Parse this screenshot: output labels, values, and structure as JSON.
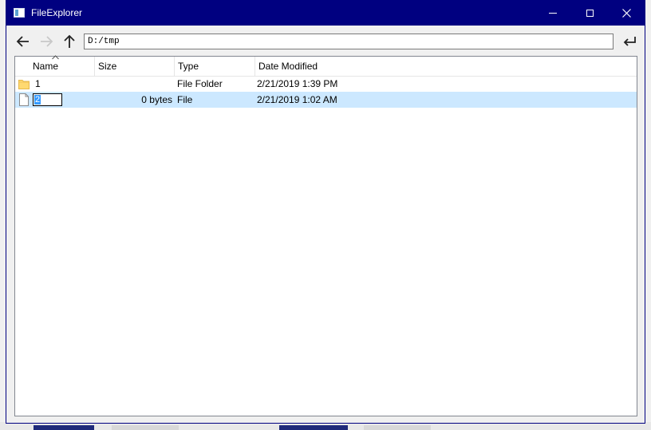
{
  "window": {
    "title": "FileExplorer"
  },
  "toolbar": {
    "back_icon": "arrow-left-icon",
    "forward_icon": "arrow-right-icon",
    "up_icon": "arrow-up-icon",
    "go_icon": "enter-return-icon",
    "address_value": "D:/tmp"
  },
  "list": {
    "columns": {
      "name": "Name",
      "size": "Size",
      "type": "Type",
      "date": "Date Modified"
    },
    "sort": {
      "column": "Name",
      "direction": "ascending"
    },
    "rows": [
      {
        "name": "1",
        "size": "",
        "type": "File Folder",
        "date": "2/21/2019 1:39 PM",
        "icon": "folder-icon"
      },
      {
        "name": "2",
        "size": "0 bytes",
        "type": "File",
        "date": "2/21/2019 1:02 AM",
        "icon": "file-icon",
        "editing": true
      }
    ]
  },
  "colors": {
    "titlebar": "#000080",
    "selection": "#cce8ff",
    "text_selection": "#3399ff"
  }
}
